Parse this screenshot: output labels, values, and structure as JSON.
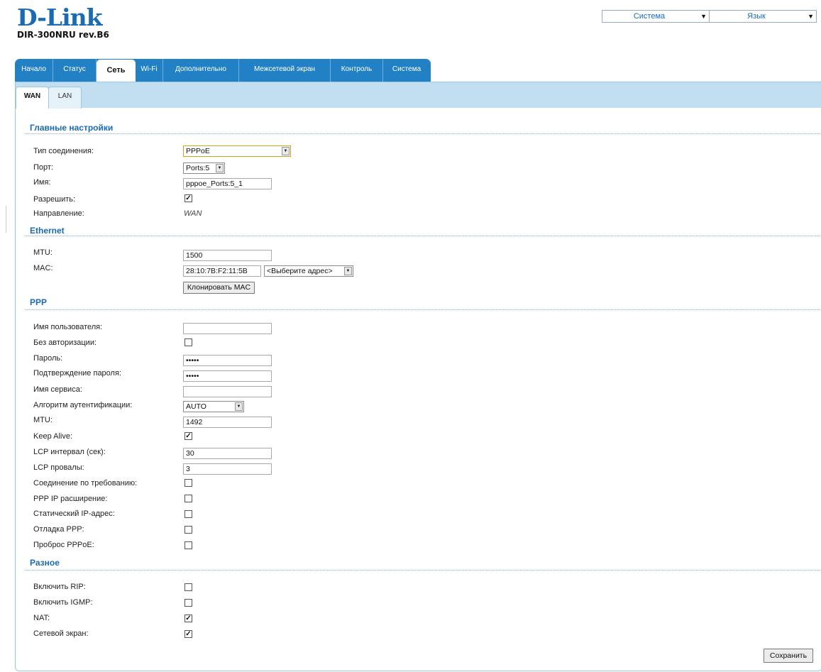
{
  "brand": {
    "logo": "D-Link",
    "model": "DIR-300NRU rev.B6"
  },
  "top_selects": {
    "system": "Система",
    "language": "Язык"
  },
  "main_tabs": [
    "Начало",
    "Статус",
    "Сеть",
    "Wi-Fi",
    "Дополнительно",
    "Межсетевой экран",
    "Контроль",
    "Система"
  ],
  "active_main_tab": "Сеть",
  "sub_tabs": [
    "WAN",
    "LAN"
  ],
  "active_sub_tab": "WAN",
  "sections": {
    "main": {
      "title": "Главные настройки",
      "connection_type_label": "Тип соединения:",
      "connection_type_value": "PPPoE",
      "port_label": "Порт:",
      "port_value": "Ports:5",
      "name_label": "Имя:",
      "name_value": "pppoe_Ports:5_1",
      "enable_label": "Разрешить:",
      "enable_checked": true,
      "direction_label": "Направление:",
      "direction_value": "WAN"
    },
    "ethernet": {
      "title": "Ethernet",
      "mtu_label": "MTU:",
      "mtu_value": "1500",
      "mac_label": "MAC:",
      "mac_value": "28:10:7B:F2:11:5B",
      "mac_select": "<Выберите адрес>",
      "clone_button": "Клонировать MAC"
    },
    "ppp": {
      "title": "PPP",
      "username_label": "Имя пользователя:",
      "username_value": "",
      "noauth_label": "Без авторизации:",
      "password_label": "Пароль:",
      "password_value": "•••••",
      "confirm_label": "Подтверждение пароля:",
      "confirm_value": "•••••",
      "service_label": "Имя сервиса:",
      "service_value": "",
      "auth_label": "Алгоритм аутентификации:",
      "auth_value": "AUTO",
      "mtu_label": "MTU:",
      "mtu_value": "1492",
      "keepalive_label": "Keep Alive:",
      "lcp_interval_label": "LCP интервал (сек):",
      "lcp_interval_value": "30",
      "lcp_fails_label": "LCP провалы:",
      "lcp_fails_value": "3",
      "on_demand_label": "Соединение по требованию:",
      "ip_ext_label": "PPP IP расширение:",
      "static_ip_label": "Статический IP-адрес:",
      "debug_label": "Отладка PPP:",
      "passthrough_label": "Проброс PPPoE:"
    },
    "misc": {
      "title": "Разное",
      "rip_label": "Включить RIP:",
      "igmp_label": "Включить IGMP:",
      "nat_label": "NAT:",
      "firewall_label": "Сетевой экран:"
    }
  },
  "save_button": "Сохранить"
}
